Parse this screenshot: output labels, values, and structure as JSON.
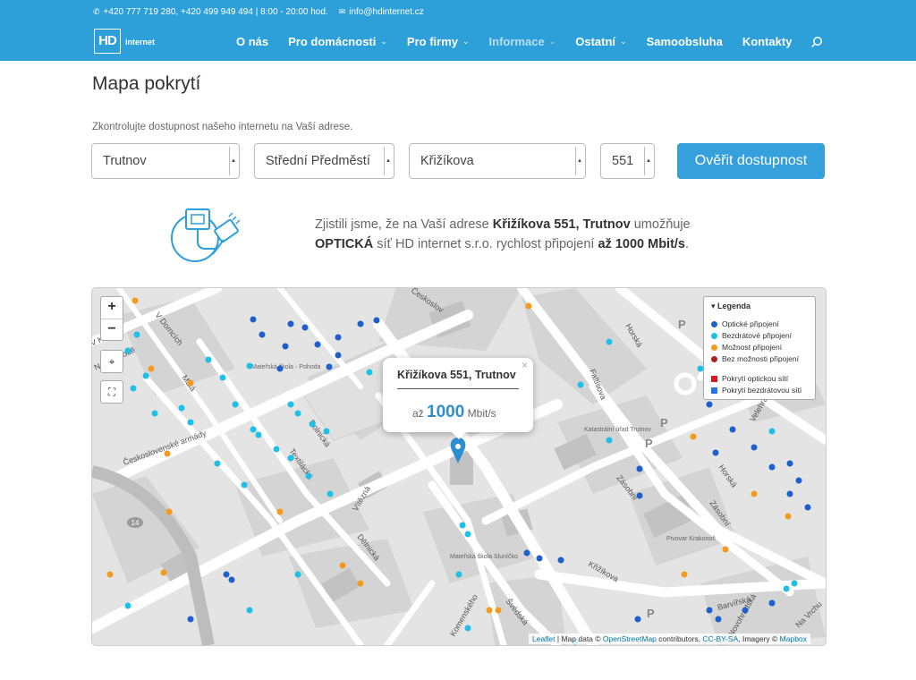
{
  "header": {
    "phone_text": "+420 777 719 280, +420 499 949 494 | 8:00 - 20:00 hod.",
    "email_text": "info@hdinternet.cz",
    "logo_mark": "HD",
    "logo_word": "internet",
    "nav": [
      {
        "label": "O nás",
        "caret": false,
        "active": false
      },
      {
        "label": "Pro domácnosti",
        "caret": true,
        "active": false
      },
      {
        "label": "Pro firmy",
        "caret": true,
        "active": false
      },
      {
        "label": "Informace",
        "caret": true,
        "active": true
      },
      {
        "label": "Ostatní",
        "caret": true,
        "active": false
      },
      {
        "label": "Samoobsluha",
        "caret": false,
        "active": false
      },
      {
        "label": "Kontakty",
        "caret": false,
        "active": false
      }
    ]
  },
  "page": {
    "title": "Mapa pokrytí",
    "intro": "Zkontrolujte dostupnost našeho internetu na Vaší adrese."
  },
  "form": {
    "city": "Trutnov",
    "district": "Střední Předměstí",
    "street": "Křižíkova",
    "number": "551",
    "submit_label": "Ověřit dostupnost"
  },
  "result": {
    "prefix": "Zjistili jsme, že na Vaší adrese ",
    "address": "Křižíkova 551, Trutnov",
    "middle1": " umožňuje ",
    "type": "OPTICKÁ",
    "middle2": " síť HD internet s.r.o. rychlost připojení ",
    "speed": "až 1000 Mbit/s",
    "suffix": "."
  },
  "map": {
    "popup_title": "Křižíkova 551, Trutnov",
    "popup_prefix": "až",
    "popup_speed": "1000",
    "popup_unit": "Mbit/s",
    "zoom_in": "+",
    "zoom_out": "−",
    "legend": {
      "title": "Legenda",
      "items": [
        {
          "label": "Optické připojení",
          "color": "#1f5fcc",
          "shape": "dot"
        },
        {
          "label": "Bezdrátové připojení",
          "color": "#1ec0e8",
          "shape": "dot"
        },
        {
          "label": "Možnost připojení",
          "color": "#f39a1f",
          "shape": "dot"
        },
        {
          "label": "Bez možnosti připojení",
          "color": "#b3201a",
          "shape": "dot"
        },
        {
          "label": "Pokrytí optickou sítí",
          "color": "#e8101a",
          "shape": "square"
        },
        {
          "label": "Pokrytí bezdrátovou sítí",
          "color": "#2672e8",
          "shape": "square"
        }
      ]
    },
    "streets": [
      "V Domcích",
      "V Kopci",
      "Na Svobodě",
      "Malá",
      "Československé armády",
      "Rolnická",
      "Textilácká",
      "Vítězná",
      "Dělnická",
      "Komenského",
      "Švédská",
      "Faltisova",
      "Horská",
      "Zásobní",
      "Křižíkova",
      "Barvířská",
      "Novohradská",
      "Na Vrchu",
      "Velehradská",
      "Českoslov"
    ],
    "places": [
      "Mateřská škola - Pohoda",
      "Mateřská škola Sluníčko",
      "Katastrální úřad Trutnov",
      "Pivovar Krakonoš"
    ],
    "attribution": {
      "leaflet": "Leaflet",
      "sep1": " | Map data © ",
      "osm": "OpenStreetMap",
      "sep2": " contributors, ",
      "license": "CC-BY-SA",
      "sep3": ", Imagery © ",
      "mapbox": "Mapbox"
    }
  }
}
